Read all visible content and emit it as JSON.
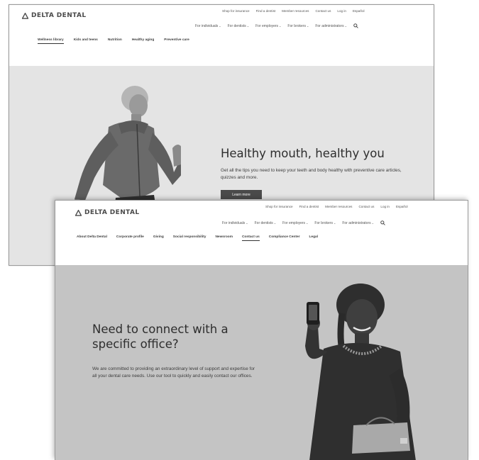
{
  "back": {
    "logo": "DELTA DENTAL",
    "utility_links": [
      "Shop for insurance",
      "Find a dentist",
      "Member resources",
      "Contact us",
      "Log in",
      "Español"
    ],
    "primary_nav": [
      "For individuals",
      "For dentists",
      "For employers",
      "For brokers",
      "For administrators"
    ],
    "sub_nav": [
      "Wellness library",
      "Kids and teens",
      "Nutrition",
      "Healthy aging",
      "Preventive care"
    ],
    "active_sub": 0,
    "hero": {
      "title": "Healthy mouth, healthy you",
      "text": "Get all the tips you need to keep your teeth and body healthy with preventive care articles, quizzes and more.",
      "button": "Learn more"
    }
  },
  "front": {
    "logo": "DELTA DENTAL",
    "utility_links": [
      "Shop for insurance",
      "Find a dentist",
      "Member resources",
      "Contact us",
      "Log in",
      "Español"
    ],
    "primary_nav": [
      "For individuals",
      "For dentists",
      "For employers",
      "For brokers",
      "For administrators"
    ],
    "sub_nav": [
      "About Delta Dental",
      "Corporate profile",
      "Giving",
      "Social responsibility",
      "Newsroom",
      "Contact us",
      "Compliance Center",
      "Legal"
    ],
    "active_sub": 5,
    "hero": {
      "title": "Need to connect with a specific office?",
      "text": "We are committed to providing an extraordinary level of support and expertise for all your dental care needs. Use our tool to quickly and easily contact our offices."
    }
  },
  "icons": {
    "logo": "delta-triangle-icon",
    "search": "search-icon",
    "dropdown": "chevron-down-icon"
  },
  "colors": {
    "hero_back": "#e4e4e4",
    "hero_front": "#c4c4c4",
    "button": "#4a4a4a"
  }
}
